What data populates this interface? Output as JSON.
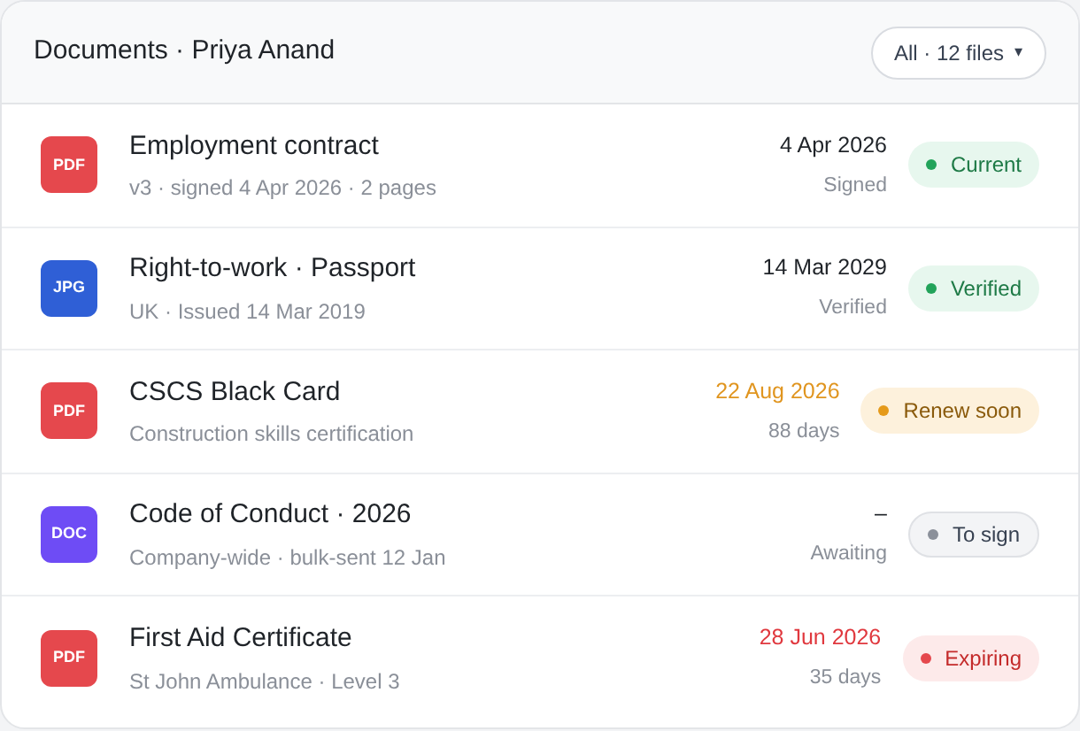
{
  "header": {
    "title": "Documents · Priya Anand",
    "filter": {
      "label": "All · 12 files",
      "caret": "▾"
    }
  },
  "documents": [
    {
      "file_type": "PDF",
      "color": "#e5484d",
      "title": "Employment contract",
      "subtitle": "v3 · signed 4 Apr 2026 · 2 pages",
      "date": "4 Apr 2026",
      "note": "Signed",
      "status": {
        "label": "Current",
        "kind": "success"
      }
    },
    {
      "file_type": "JPG",
      "color": "#2f5fd6",
      "title": "Right-to-work · Passport",
      "subtitle": "UK · Issued 14 Mar 2019",
      "date": "14 Mar 2029",
      "note": "Verified",
      "status": {
        "label": "Verified",
        "kind": "success"
      }
    },
    {
      "file_type": "PDF",
      "color": "#e5484d",
      "title": "CSCS Black Card",
      "subtitle": "Construction skills certification",
      "date": "22 Aug 2026",
      "note": "88 days",
      "status": {
        "label": "Renew soon",
        "kind": "warning"
      }
    },
    {
      "file_type": "DOC",
      "color": "#6e4cf5",
      "title": "Code of Conduct · 2026",
      "subtitle": "Company-wide · bulk-sent 12 Jan",
      "date": "–",
      "note": "Awaiting",
      "status": {
        "label": "To sign",
        "kind": "neutral"
      }
    },
    {
      "file_type": "PDF",
      "color": "#e5484d",
      "title": "First Aid Certificate",
      "subtitle": "St John Ambulance · Level 3",
      "date": "28 Jun 2026",
      "note": "35 days",
      "status": {
        "label": "Expiring",
        "kind": "danger"
      }
    }
  ]
}
